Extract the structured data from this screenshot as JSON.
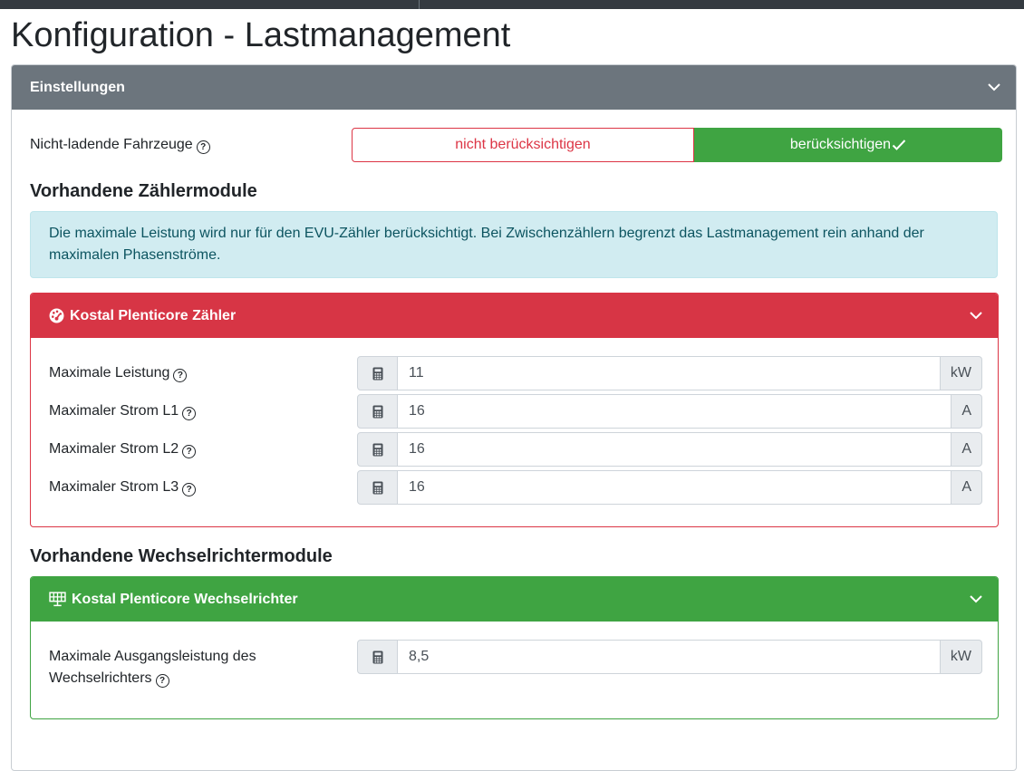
{
  "page": {
    "title": "Konfiguration - Lastmanagement"
  },
  "settings": {
    "header": "Einstellungen",
    "non_charging": {
      "label": "Nicht-ladende Fahrzeuge",
      "option_off": "nicht berücksichtigen",
      "option_on": "berücksichtigen",
      "selected": "berücksichtigen"
    },
    "meter_section": {
      "title": "Vorhandene Zählermodule",
      "info": "Die maximale Leistung wird nur für den EVU-Zähler berücksichtigt. Bei Zwischenzählern begrenzt das Lastmanagement rein anhand der maximalen Phasenströme."
    },
    "meter_card": {
      "title": "Kostal Plenticore Zähler",
      "color": "#d73545",
      "fields": [
        {
          "label": "Maximale Leistung",
          "value": "11",
          "unit": "kW"
        },
        {
          "label": "Maximaler Strom L1",
          "value": "16",
          "unit": "A"
        },
        {
          "label": "Maximaler Strom L2",
          "value": "16",
          "unit": "A"
        },
        {
          "label": "Maximaler Strom L3",
          "value": "16",
          "unit": "A"
        }
      ]
    },
    "inverter_section": {
      "title": "Vorhandene Wechselrichtermodule"
    },
    "inverter_card": {
      "title": "Kostal Plenticore Wechselrichter",
      "color": "#3fa442",
      "field": {
        "label_line1": "Maximale Ausgangsleistung des",
        "label_line2": "Wechselrichters",
        "value": "8,5",
        "unit": "kW"
      }
    }
  },
  "icons": {
    "help": "question-circle-icon",
    "calculator": "calculator-icon",
    "chevron": "chevron-down-icon",
    "meter": "tachometer-icon",
    "inverter": "solar-panel-icon",
    "check": "check-icon"
  }
}
